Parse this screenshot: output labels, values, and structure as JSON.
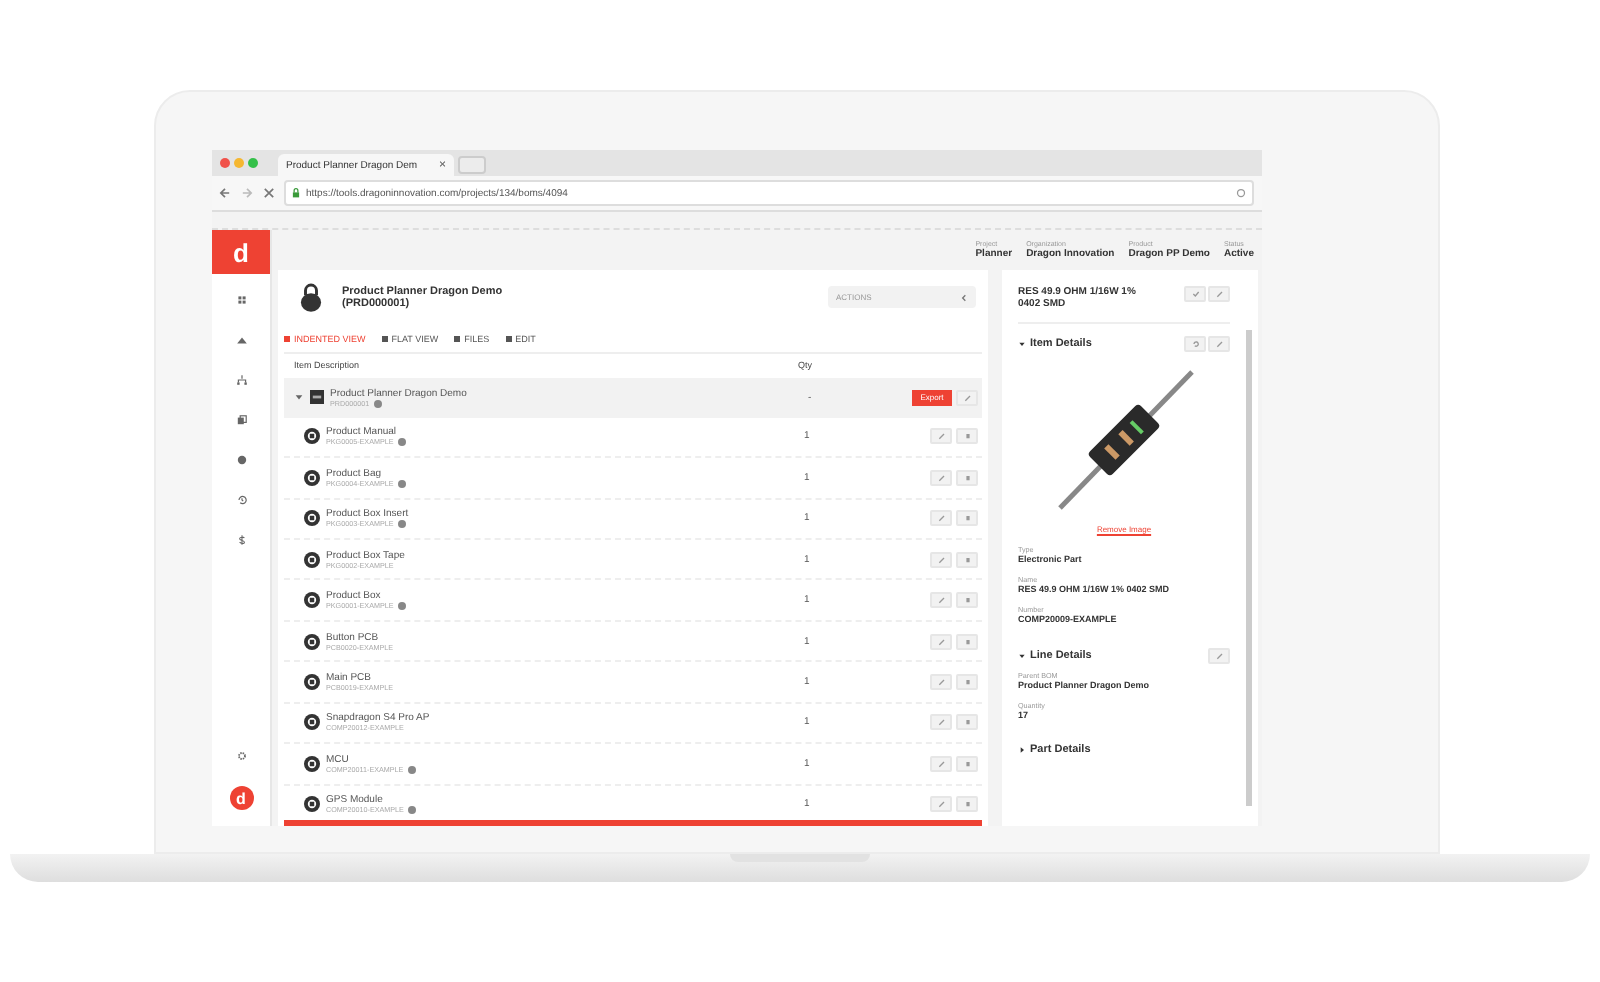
{
  "browser": {
    "tab_title": "Product Planner Dragon Dem",
    "tab_close": "×",
    "url": "https://tools.dragoninnovation.com/projects/134/boms/4094"
  },
  "sidebar": {
    "logo": "d",
    "avatar": "d",
    "items": [
      {
        "kind": "grid"
      },
      {
        "kind": "org"
      },
      {
        "kind": "tree"
      },
      {
        "kind": "copy"
      },
      {
        "kind": "globe"
      },
      {
        "kind": "history"
      },
      {
        "kind": "dollar"
      }
    ]
  },
  "header_fields": [
    {
      "label": "Project",
      "value": "Planner"
    },
    {
      "label": "Organization",
      "value": "Dragon Innovation"
    },
    {
      "label": "Product",
      "value": "Dragon PP Demo"
    },
    {
      "label": "Status",
      "value": "Active"
    }
  ],
  "bom": {
    "title": "Product Planner Dragon Demo",
    "code": "(PRD000001)",
    "actions": "ACTIONS",
    "tabs": [
      {
        "label": "INDENTED VIEW",
        "selected": true
      },
      {
        "label": "FLAT VIEW",
        "selected": false
      },
      {
        "label": "FILES",
        "selected": false
      },
      {
        "label": "EDIT",
        "selected": false
      }
    ],
    "columns": [
      "Item Description",
      "Qty"
    ],
    "parent": {
      "name": "Product Planner Dragon Demo",
      "number": "PRD000001",
      "qty": "-",
      "badge": "Export"
    },
    "rows": [
      {
        "name": "Product Manual",
        "number": "PKG0005-EXAMPLE",
        "qty": "1",
        "info": true
      },
      {
        "name": "Product Bag",
        "number": "PKG0004-EXAMPLE",
        "qty": "1",
        "info": true
      },
      {
        "name": "Product Box Insert",
        "number": "PKG0003-EXAMPLE",
        "qty": "1",
        "info": true
      },
      {
        "name": "Product Box Tape",
        "number": "PKG0002-EXAMPLE",
        "qty": "1",
        "info": false
      },
      {
        "name": "Product Box",
        "number": "PKG0001-EXAMPLE",
        "qty": "1",
        "info": true
      },
      {
        "name": "Button PCB",
        "number": "PCB0020-EXAMPLE",
        "qty": "1",
        "info": false
      },
      {
        "name": "Main PCB",
        "number": "PCB0019-EXAMPLE",
        "qty": "1",
        "info": false
      },
      {
        "name": "Snapdragon S4 Pro AP",
        "number": "COMP20012-EXAMPLE",
        "qty": "1",
        "info": false
      },
      {
        "name": "MCU",
        "number": "COMP20011-EXAMPLE",
        "qty": "1",
        "info": true
      },
      {
        "name": "GPS Module",
        "number": "COMP20010-EXAMPLE",
        "qty": "1",
        "info": true
      }
    ]
  },
  "detail": {
    "title": "RES 49.9 OHM 1/16W 1% 0402 SMD",
    "item_section": "Item Details",
    "remove_image": "Remove Image",
    "item_fields": [
      {
        "label": "Type",
        "value": "Electronic Part"
      },
      {
        "label": "Name",
        "value": "RES 49.9 OHM 1/16W 1% 0402 SMD"
      },
      {
        "label": "Number",
        "value": "COMP20009-EXAMPLE"
      }
    ],
    "line_section": "Line Details",
    "line_fields": [
      {
        "label": "Parent BOM",
        "value": "Product Planner Dragon Demo"
      },
      {
        "label": "Quantity",
        "value": "17"
      }
    ],
    "next_section": "Part Details"
  }
}
